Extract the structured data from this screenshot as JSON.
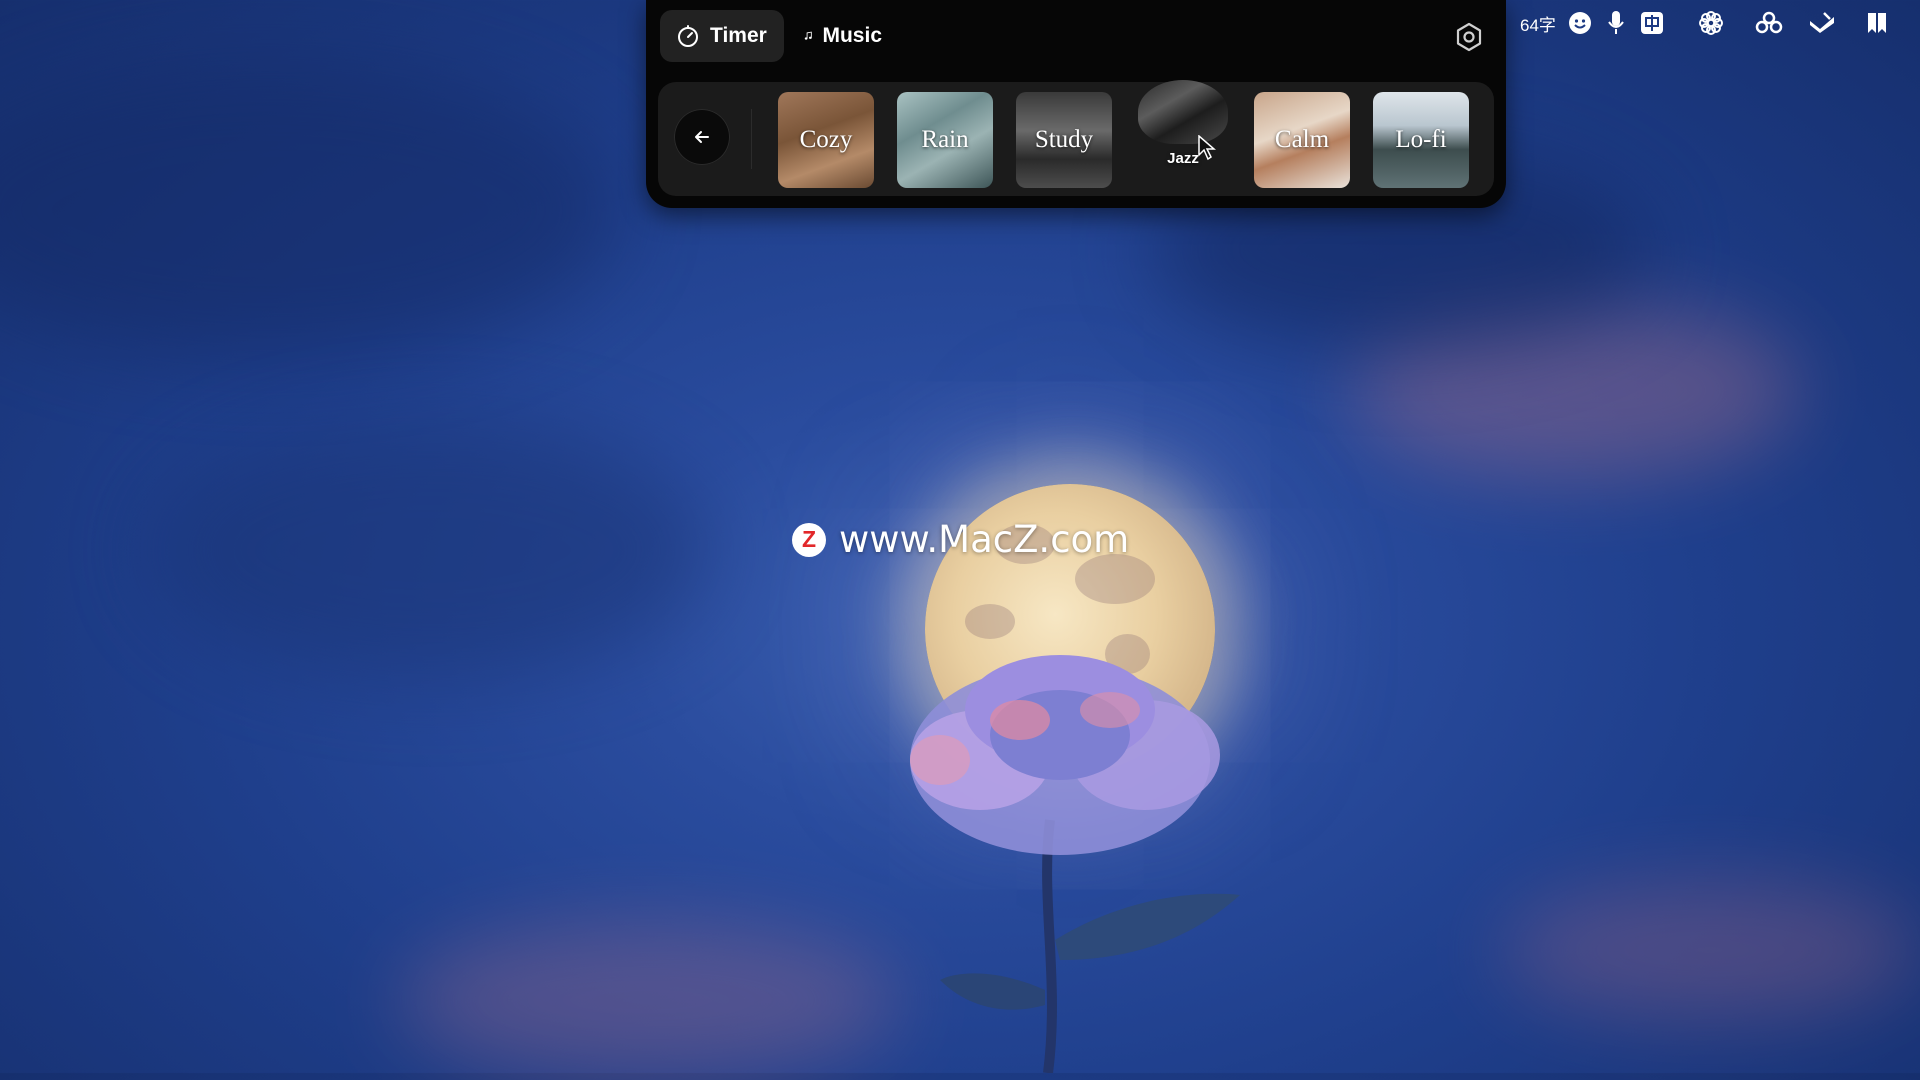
{
  "widget": {
    "tabs": [
      {
        "label": "Timer",
        "icon": "timer-icon",
        "active": true
      },
      {
        "label": "Music",
        "icon": "music-note-icon",
        "active": false
      }
    ],
    "settings_icon": "settings-icon",
    "back_icon": "arrow-left-icon",
    "moods": [
      {
        "label": "Cozy"
      },
      {
        "label": "Rain"
      },
      {
        "label": "Study"
      },
      {
        "label": "Jazz"
      },
      {
        "label": "Calm"
      },
      {
        "label": "Lo-fi"
      }
    ]
  },
  "menubar": {
    "word_count": "64字",
    "icons": [
      "smiley-icon",
      "microphone-icon",
      "input-method-icon",
      "flower-icon",
      "cloud-sync-icon",
      "hand-tray-icon",
      "bookmark-grid-icon"
    ]
  },
  "watermark": {
    "text": "www.MacZ.com",
    "logo_letter": "Z"
  }
}
